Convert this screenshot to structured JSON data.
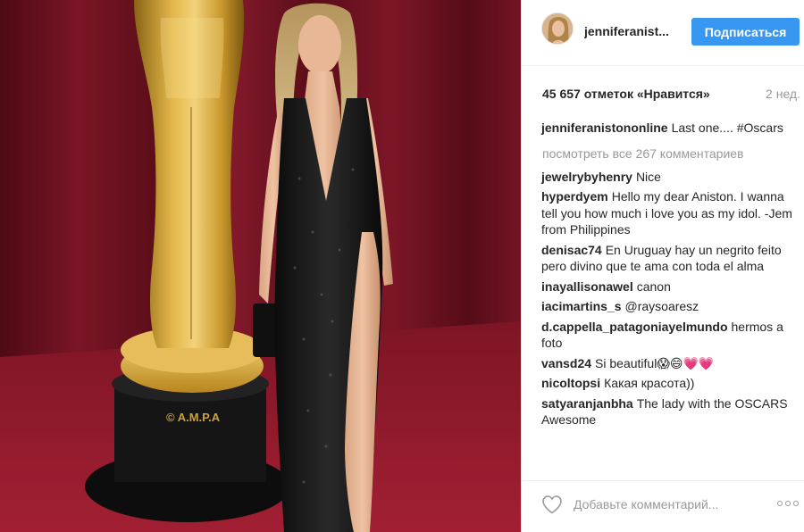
{
  "post": {
    "username": "jenniferanist...",
    "follow_label": "Подписаться",
    "likes": "45 657 отметок «Нравится»",
    "time": "2 нед.",
    "caption_user": "jenniferanistononline",
    "caption_text": "Last one.... #Oscars",
    "view_all": "посмотреть все 267 комментариев",
    "comments": [
      {
        "user": "jewelrybyhenry",
        "text": "Nice"
      },
      {
        "user": "hyperdyem",
        "text": "Hello my dear Aniston. I wanna tell you how much i love you as my idol. -Jem from Philippines"
      },
      {
        "user": "denisac74",
        "text": "En Uruguay hay un negrito feito pero divino que te ama con toda el alma"
      },
      {
        "user": "inayallisonawel",
        "text": "canon"
      },
      {
        "user": "iacimartins_s",
        "text": "@raysoaresz"
      },
      {
        "user": "d.cappella_patagoniayelmundo",
        "text": "hermos a foto"
      },
      {
        "user": "vansd24",
        "text": "Si beautiful😱😄💗💗"
      },
      {
        "user": "nicoltopsi",
        "text": "Какая красота))"
      },
      {
        "user": "satyaranjanbha",
        "text": "The lady with the OSCARS Awesome"
      }
    ],
    "comment_placeholder": "Добавьте комментарий...",
    "statue_base_text": "© A.M.P.A"
  },
  "icons": {
    "heart": "heart-icon",
    "more": "more-options-icon"
  },
  "colors": {
    "accent": "#3897f0",
    "muted": "#999999",
    "text": "#262626",
    "border": "#efefef"
  }
}
